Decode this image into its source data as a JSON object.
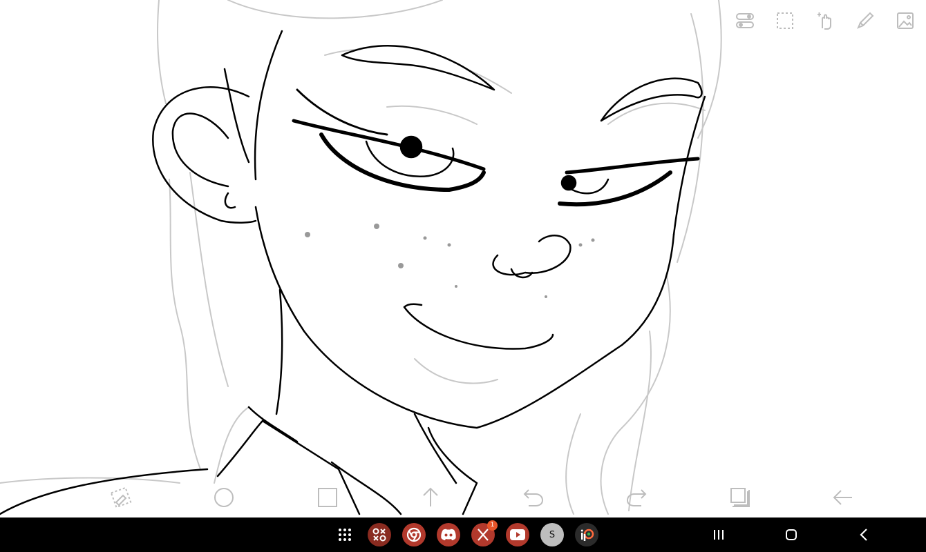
{
  "app": {
    "name": "ibis Paint"
  },
  "top_toolbar": {
    "items": [
      {
        "name": "toggle-panel-icon"
      },
      {
        "name": "selection-tool-icon"
      },
      {
        "name": "hand-tool-icon"
      },
      {
        "name": "brush-tool-icon"
      },
      {
        "name": "layer-image-icon"
      }
    ]
  },
  "bottom_toolbar": {
    "items": [
      {
        "name": "transform-icon"
      },
      {
        "name": "ellipse-icon"
      },
      {
        "name": "rectangle-icon"
      },
      {
        "name": "arrow-up-icon"
      },
      {
        "name": "undo-icon"
      },
      {
        "name": "redo-icon"
      },
      {
        "name": "layers-icon"
      },
      {
        "name": "back-arrow-icon"
      }
    ]
  },
  "taskbar": {
    "apps": [
      {
        "name": "app-drawer",
        "color": "#000000"
      },
      {
        "name": "games-launcher",
        "color": "#c2392b"
      },
      {
        "name": "chrome",
        "color": "#cf3b2c"
      },
      {
        "name": "discord",
        "color": "#c93a2a"
      },
      {
        "name": "x",
        "color": "#c93a2a",
        "badge": "1"
      },
      {
        "name": "youtube",
        "color": "#cf3b2c"
      },
      {
        "name": "profile",
        "color": "#bdbdbd",
        "label": "S"
      },
      {
        "name": "ibis-paint",
        "color": "#2b2b2b"
      }
    ],
    "nav": [
      {
        "name": "recents-key"
      },
      {
        "name": "home-key"
      },
      {
        "name": "back-key"
      }
    ]
  },
  "colors": {
    "canvas": "#ffffff",
    "ink": "#000000",
    "sketch": "#c8c8c8",
    "toolbar_icon": "#bdbdbd",
    "taskbar": "#000000"
  }
}
